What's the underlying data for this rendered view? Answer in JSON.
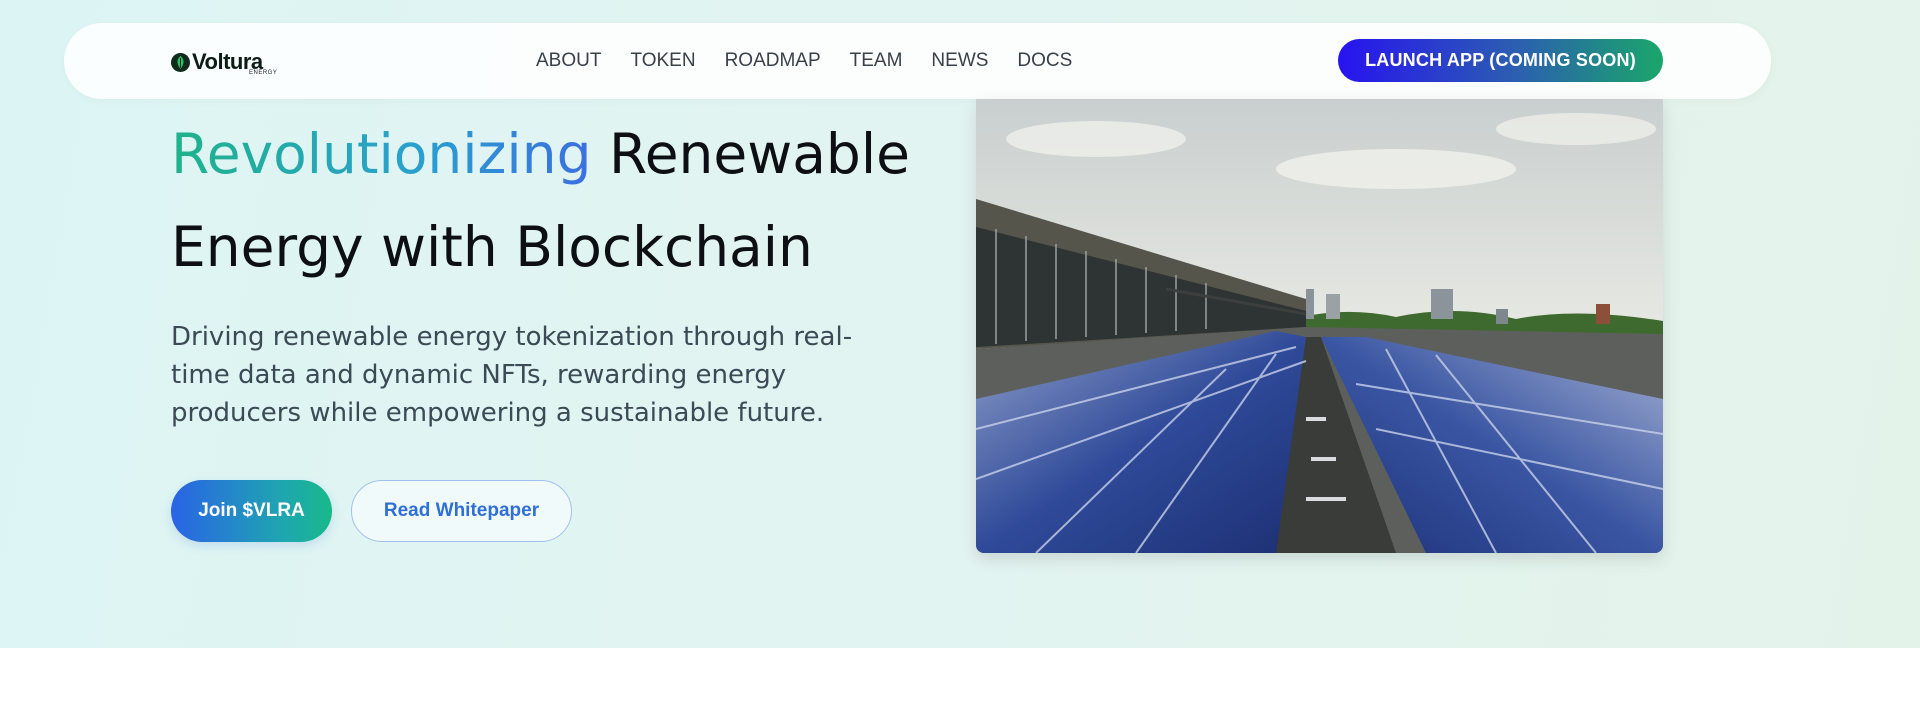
{
  "brand": {
    "name": "Voltura",
    "sub": "ENERGY"
  },
  "nav": {
    "links": [
      "ABOUT",
      "TOKEN",
      "ROADMAP",
      "TEAM",
      "NEWS",
      "DOCS"
    ],
    "cta": "LAUNCH APP (COMING SOON)"
  },
  "hero": {
    "headline_highlight": "Revolutionizing",
    "headline_rest_line1": " Renewable",
    "headline_line2": "Energy with Blockchain",
    "description": "Driving renewable energy tokenization through real-time data and dynamic NFTs, rewarding energy producers while empowering a sustainable future.",
    "primary_button": "Join $VLRA",
    "secondary_button": "Read Whitepaper"
  },
  "colors": {
    "accent_gradient_start": "#2713f0",
    "accent_gradient_end": "#1aa66a",
    "headline_gradient_start": "#1fb38a",
    "headline_gradient_end": "#3b6fe0",
    "link_blue": "#2f6fd6"
  },
  "icons": {
    "logo": "leaf-logo-icon"
  }
}
